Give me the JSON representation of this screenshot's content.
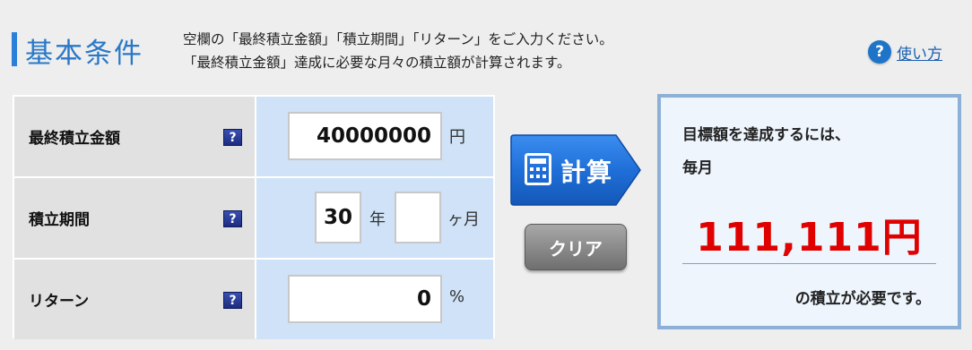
{
  "header": {
    "title": "基本条件",
    "instructions_line1": "空欄の「最終積立金額」「積立期間」「リターン」をご入力ください。",
    "instructions_line2": "「最終積立金額」達成に必要な月々の積立額が計算されます。",
    "help_label": "使い方",
    "help_icon": "question-circle-icon"
  },
  "form": {
    "rows": [
      {
        "label": "最終積立金額",
        "value": "40000000",
        "unit": "円"
      },
      {
        "label": "積立期間",
        "years_value": "30",
        "years_unit": "年",
        "months_value": "",
        "months_unit": "ヶ月"
      },
      {
        "label": "リターン",
        "value": "0",
        "unit": "%"
      }
    ],
    "help_marker": "?"
  },
  "buttons": {
    "calculate_label": "計算",
    "calculate_icon": "calculator-icon",
    "clear_label": "クリア"
  },
  "result": {
    "line1": "目標額を達成するには、",
    "line2": "毎月",
    "amount": "111,111円",
    "suffix": "の積立が必要です。"
  },
  "colors": {
    "accent_blue": "#2a78c8",
    "input_cell_bg": "#cfe2f7",
    "result_amount": "#e00000"
  }
}
